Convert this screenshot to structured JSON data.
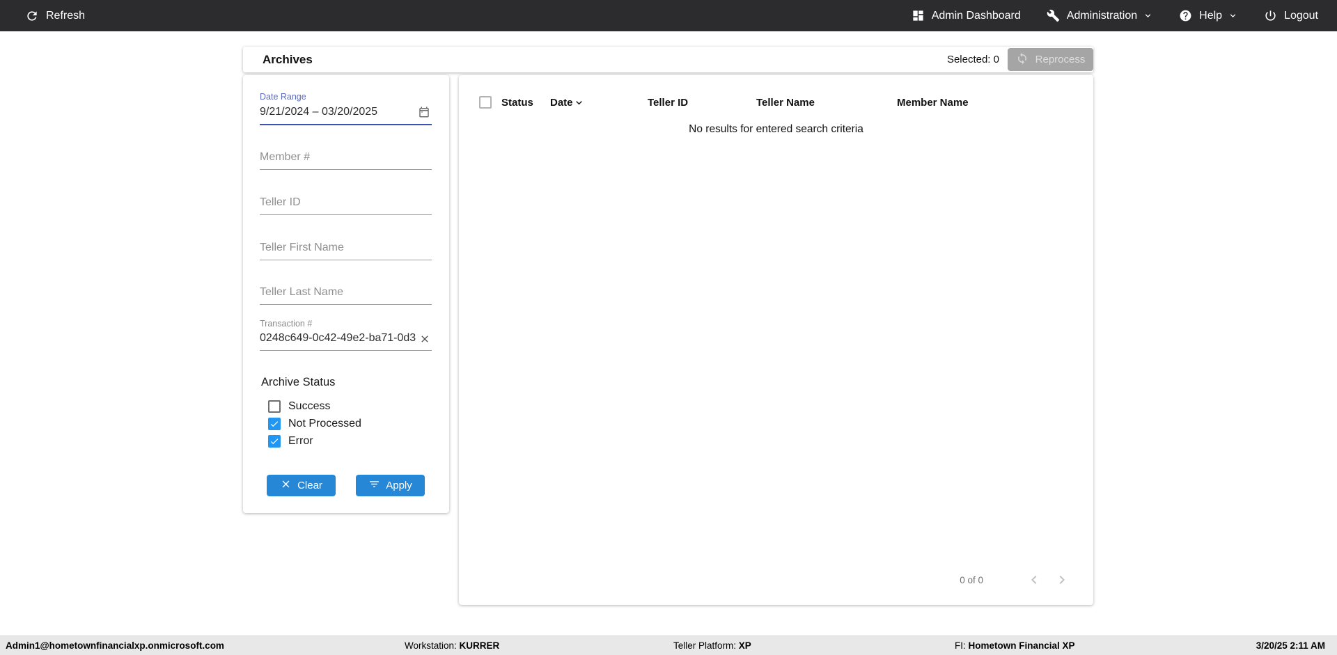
{
  "topbar": {
    "refresh": "Refresh",
    "admin_dashboard": "Admin Dashboard",
    "administration": "Administration",
    "help": "Help",
    "logout": "Logout"
  },
  "header": {
    "title": "Archives",
    "selected_label": "Selected: 0",
    "reprocess_label": "Reprocess"
  },
  "filters": {
    "date_range": {
      "label": "Date Range",
      "value": "9/21/2024 – 03/20/2025"
    },
    "member_number": {
      "placeholder": "Member #"
    },
    "teller_id": {
      "placeholder": "Teller ID"
    },
    "teller_first_name": {
      "placeholder": "Teller First Name"
    },
    "teller_last_name": {
      "placeholder": "Teller Last Name"
    },
    "transaction_number": {
      "label": "Transaction #",
      "value": "0248c649-0c42-49e2-ba71-0d3"
    },
    "archive_status": {
      "label": "Archive Status",
      "options": [
        {
          "label": "Success",
          "checked": false
        },
        {
          "label": "Not Processed",
          "checked": true
        },
        {
          "label": "Error",
          "checked": true
        }
      ]
    },
    "clear_label": "Clear",
    "apply_label": "Apply"
  },
  "table": {
    "columns": [
      "Status",
      "Date",
      "Teller ID",
      "Teller Name",
      "Member Name"
    ],
    "empty_message": "No results for entered search criteria",
    "pagination": "0 of 0"
  },
  "statusbar": {
    "user": "Admin1@hometownfinancialxp.onmicrosoft.com",
    "workstation_label": "Workstation: ",
    "workstation_value": "KURRER",
    "platform_label": "Teller Platform: ",
    "platform_value": "XP",
    "fi_label": "FI: ",
    "fi_value": "Hometown Financial XP",
    "datetime": "3/20/25 2:11 AM"
  },
  "colors": {
    "topbar_bg": "#2c2c2e",
    "accent_blue": "#2787d7",
    "checkbox_blue": "#2196f3",
    "focused_underline": "#3b53ad",
    "disabled_button": "#a5a5a5",
    "statusbar_bg": "#e8e8e8"
  }
}
